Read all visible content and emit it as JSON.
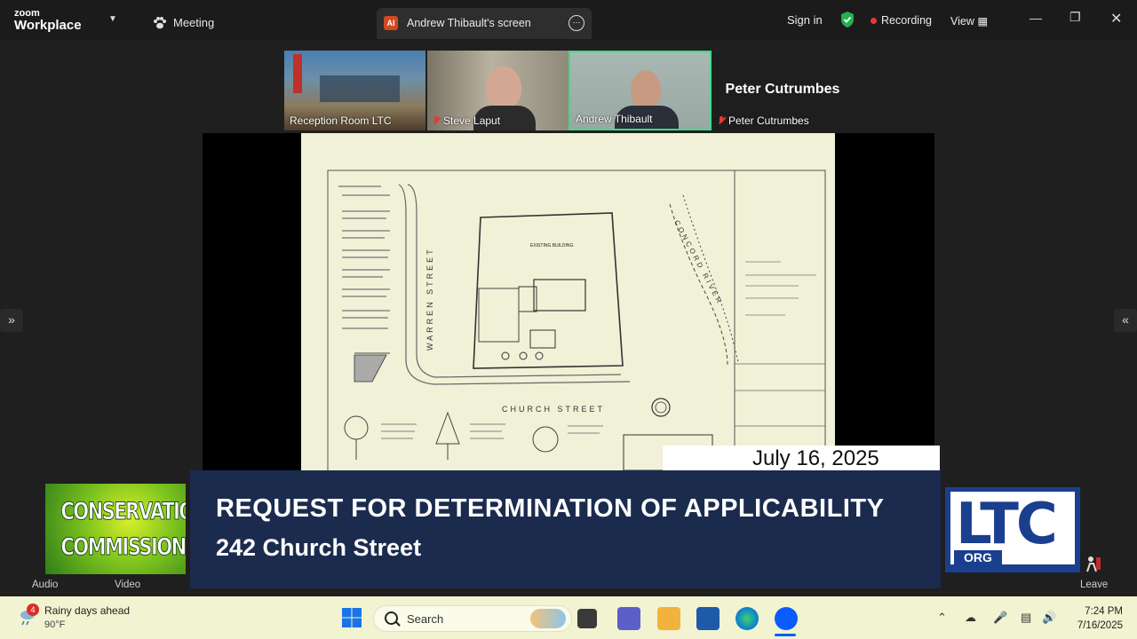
{
  "topbar": {
    "app_name_small": "zoom",
    "app_name": "Workplace",
    "meeting_label": "Meeting",
    "share_initials": "AI",
    "share_label": "Andrew Thibault's screen",
    "sign_in": "Sign in",
    "recording": "Recording",
    "view": "View"
  },
  "participants": [
    {
      "name": "Reception Room LTC",
      "muted": false
    },
    {
      "name": "Steve Laput",
      "muted": true
    },
    {
      "name": "Andrew Thibault",
      "muted": false
    },
    {
      "name": "Peter Cutrumbes",
      "muted": true,
      "tile_title": "Peter Cutrumbes"
    }
  ],
  "plan_labels": {
    "street_left": "WARREN   STREET",
    "street_bottom": "CHURCH   STREET",
    "river": "CONCORD RIVER",
    "building": "EXISTING BUILDING"
  },
  "lower_third": {
    "date": "July 16, 2025",
    "title": "REQUEST FOR DETERMINATION OF APPLICABILITY",
    "subtitle": "242 Church Street",
    "cc_logo_line1": "CONSERVATION",
    "cc_logo_line2": "COMMISSION",
    "ltc_logo": "LTC",
    "ltc_org": "ORG"
  },
  "controls": {
    "audio": "Audio",
    "video": "Video",
    "leave": "Leave"
  },
  "taskbar": {
    "weather_badge": "4",
    "weather_text": "Rainy days ahead",
    "weather_temp": "90°F",
    "search_label": "Search",
    "time": "7:24 PM",
    "date": "7/16/2025"
  },
  "colors": {
    "lower_third_bg": "#1b2b4e",
    "recording_dot": "#e53935",
    "active_speaker_border": "#3ddc84"
  }
}
